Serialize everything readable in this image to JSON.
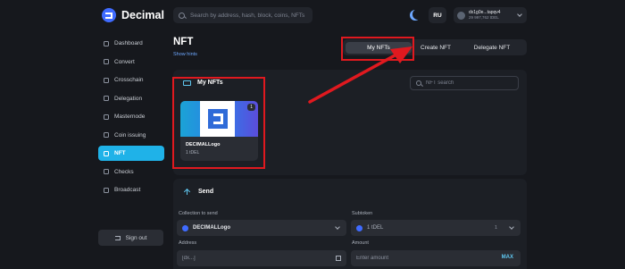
{
  "brand": {
    "name": "Decimal"
  },
  "search": {
    "placeholder": "Search by address, hash, block, coins, NFTs"
  },
  "header": {
    "language": "RU",
    "account_address": "dx1g0e...tapqv4",
    "account_balance": "29 997,762 tDEL"
  },
  "sidebar": {
    "items": [
      {
        "label": "Dashboard",
        "icon": "dashboard-icon"
      },
      {
        "label": "Convert",
        "icon": "convert-icon"
      },
      {
        "label": "Crosschain",
        "icon": "crosschain-icon"
      },
      {
        "label": "Delegation",
        "icon": "delegation-icon"
      },
      {
        "label": "Masternode",
        "icon": "masternode-icon"
      },
      {
        "label": "Coin issuing",
        "icon": "coin-issuing-icon"
      },
      {
        "label": "NFT",
        "icon": "nft-icon",
        "active": true
      },
      {
        "label": "Checks",
        "icon": "checks-icon"
      },
      {
        "label": "Broadcast",
        "icon": "broadcast-icon"
      }
    ],
    "signout_label": "Sign out"
  },
  "page": {
    "title": "NFT",
    "hints_link": "Show hints"
  },
  "tabs": [
    {
      "label": "My NFTs",
      "active": true
    },
    {
      "label": "Create NFT"
    },
    {
      "label": "Delegate NFT"
    }
  ],
  "my_nfts": {
    "title": "My NFTs",
    "search_placeholder": "NFT search",
    "cards": [
      {
        "name": "DECIMALLogo",
        "price": "1 tDEL",
        "badge": "1"
      }
    ]
  },
  "send": {
    "title": "Send",
    "collection_label": "Collection to send",
    "collection_value": "DECIMALLogo",
    "subtoken_label": "Subtoken",
    "subtoken_name": "1 tDEL",
    "subtoken_value": "1",
    "address_label": "Address",
    "address_placeholder": "[dx...]",
    "amount_label": "Amount",
    "amount_placeholder": "Enter amount",
    "max_label": "MAX"
  },
  "colors": {
    "accent": "#1fb2e8",
    "highlight": "#e0191f",
    "background": "#16181d"
  }
}
